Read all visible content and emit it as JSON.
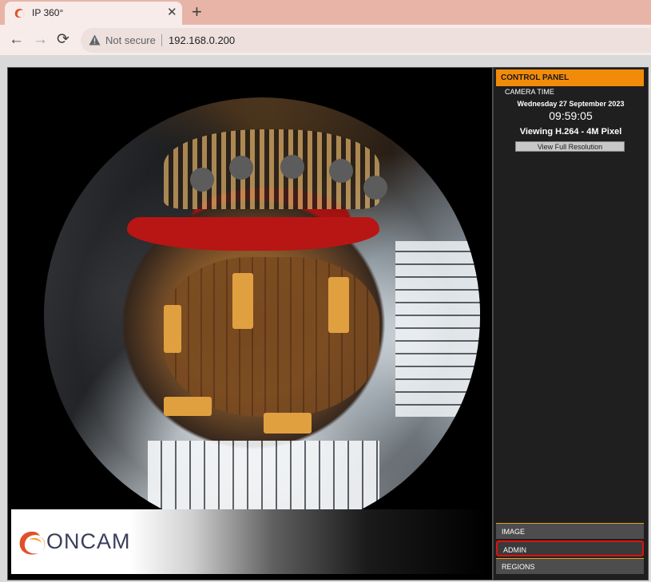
{
  "browser": {
    "tab": {
      "title": "IP 360°",
      "close_glyph": "✕"
    },
    "new_tab_glyph": "+",
    "nav": {
      "back": "←",
      "forward": "→",
      "reload": "⟳"
    },
    "address_bar": {
      "security_label": "Not secure",
      "url": "192.168.0.200"
    }
  },
  "viewer": {
    "logo_text": "ONCAM"
  },
  "control_panel": {
    "header": "CONTROL PANEL",
    "camera_time_label": "CAMERA TIME",
    "date": "Wednesday 27 September 2023",
    "time": "09:59:05",
    "viewing": "Viewing H.264 - 4M Pixel",
    "full_res_button": "View Full Resolution",
    "menu": [
      {
        "label": "IMAGE"
      },
      {
        "label": "ADMIN",
        "highlighted": true
      },
      {
        "label": "REGIONS"
      }
    ]
  },
  "colors": {
    "tabstrip": "#e8b4a8",
    "panel_header": "#f28b0a",
    "highlight": "#e01010"
  }
}
